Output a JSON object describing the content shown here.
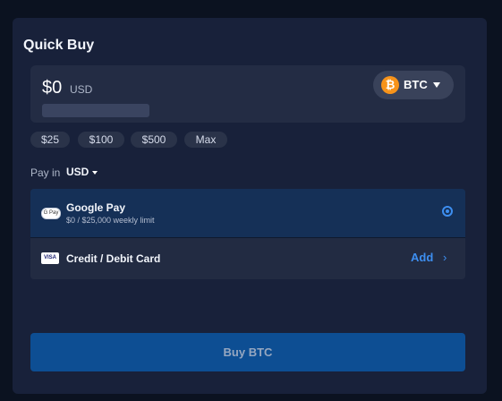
{
  "title": "Quick Buy",
  "amount": {
    "value": "$0",
    "currency": "USD"
  },
  "coin": {
    "symbol": "BTC",
    "icon": "bitcoin-icon",
    "color": "#f7931a"
  },
  "presets": [
    "$25",
    "$100",
    "$500",
    "Max"
  ],
  "pay_in": {
    "label": "Pay in",
    "currency": "USD"
  },
  "payment_methods": [
    {
      "name": "Google Pay",
      "detail": "$0 / $25,000 weekly limit",
      "selected": true,
      "icon": "google-pay-icon"
    },
    {
      "name": "Credit / Debit Card",
      "action": "Add",
      "icon": "visa-card-icon"
    }
  ],
  "buy_button": "Buy BTC",
  "colors": {
    "accent": "#3d8ef0",
    "button": "#0d4e93",
    "selected_row": "#153057"
  }
}
